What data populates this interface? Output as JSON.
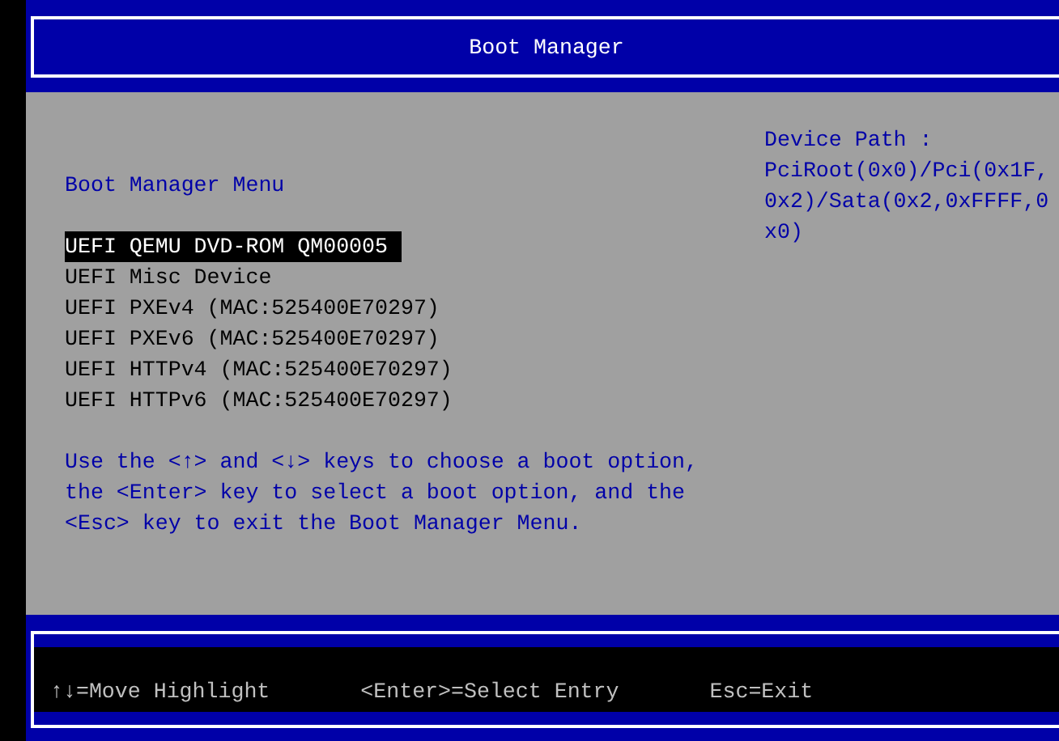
{
  "header": {
    "title": "Boot Manager"
  },
  "menu": {
    "title": "Boot Manager Menu",
    "items": [
      {
        "label": "UEFI QEMU DVD-ROM QM00005",
        "selected": true
      },
      {
        "label": "UEFI Misc Device",
        "selected": false
      },
      {
        "label": "UEFI PXEv4 (MAC:525400E70297)",
        "selected": false
      },
      {
        "label": "UEFI PXEv6 (MAC:525400E70297)",
        "selected": false
      },
      {
        "label": "UEFI HTTPv4 (MAC:525400E70297)",
        "selected": false
      },
      {
        "label": "UEFI HTTPv6 (MAC:525400E70297)",
        "selected": false
      }
    ],
    "help_lines": [
      "Use the <↑> and <↓> keys to choose a boot option,",
      "the <Enter> key to select a boot option, and the",
      "<Esc> key to exit the Boot Manager Menu."
    ]
  },
  "device_path": {
    "label": "Device Path :",
    "lines": [
      "PciRoot(0x0)/Pci(0x1F,",
      "0x2)/Sata(0x2,0xFFFF,0",
      "x0)"
    ]
  },
  "footer": {
    "hints": [
      "↑↓=Move Highlight",
      "<Enter>=Select Entry",
      "Esc=Exit"
    ]
  }
}
